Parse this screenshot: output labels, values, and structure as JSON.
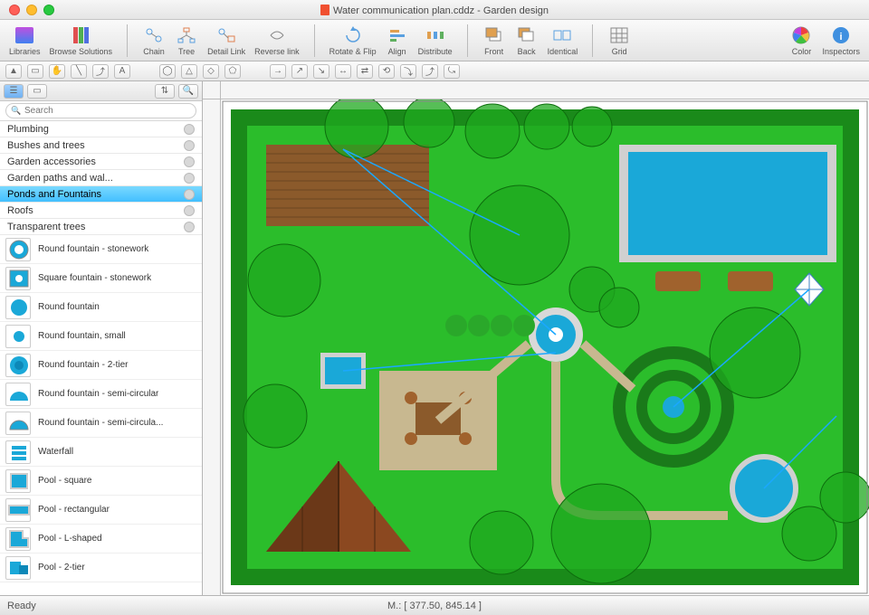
{
  "window": {
    "title": "Water communication plan.cddz - Garden design"
  },
  "toolbar": {
    "libraries": "Libraries",
    "browse": "Browse Solutions",
    "chain": "Chain",
    "tree": "Tree",
    "detail_link": "Detail Link",
    "reverse_link": "Reverse link",
    "rotate_flip": "Rotate & Flip",
    "align": "Align",
    "distribute": "Distribute",
    "front": "Front",
    "back": "Back",
    "identical": "Identical",
    "grid": "Grid",
    "color": "Color",
    "inspectors": "Inspectors"
  },
  "sidebar": {
    "search_placeholder": "Search",
    "categories": [
      {
        "label": "Plumbing"
      },
      {
        "label": "Bushes and trees"
      },
      {
        "label": "Garden accessories"
      },
      {
        "label": "Garden paths and wal..."
      },
      {
        "label": "Ponds and Fountains",
        "selected": true
      },
      {
        "label": "Roofs"
      },
      {
        "label": "Transparent trees"
      }
    ],
    "shapes": [
      {
        "label": "Round fountain - stonework",
        "icon": "round-stone"
      },
      {
        "label": "Square fountain - stonework",
        "icon": "square-stone"
      },
      {
        "label": "Round fountain",
        "icon": "round"
      },
      {
        "label": "Round fountain, small",
        "icon": "round-small"
      },
      {
        "label": "Round fountain - 2-tier",
        "icon": "round-2tier"
      },
      {
        "label": "Round fountain - semi-circular",
        "icon": "semi"
      },
      {
        "label": "Round fountain - semi-circula...",
        "icon": "semi2"
      },
      {
        "label": "Waterfall",
        "icon": "waterfall"
      },
      {
        "label": "Pool - square",
        "icon": "pool-sq"
      },
      {
        "label": "Pool - rectangular",
        "icon": "pool-rect"
      },
      {
        "label": "Pool - L-shaped",
        "icon": "pool-l"
      },
      {
        "label": "Pool - 2-tier",
        "icon": "pool-2t"
      }
    ]
  },
  "status": {
    "ready": "Ready",
    "coords": "M.: [ 377.50, 845.14 ]"
  }
}
